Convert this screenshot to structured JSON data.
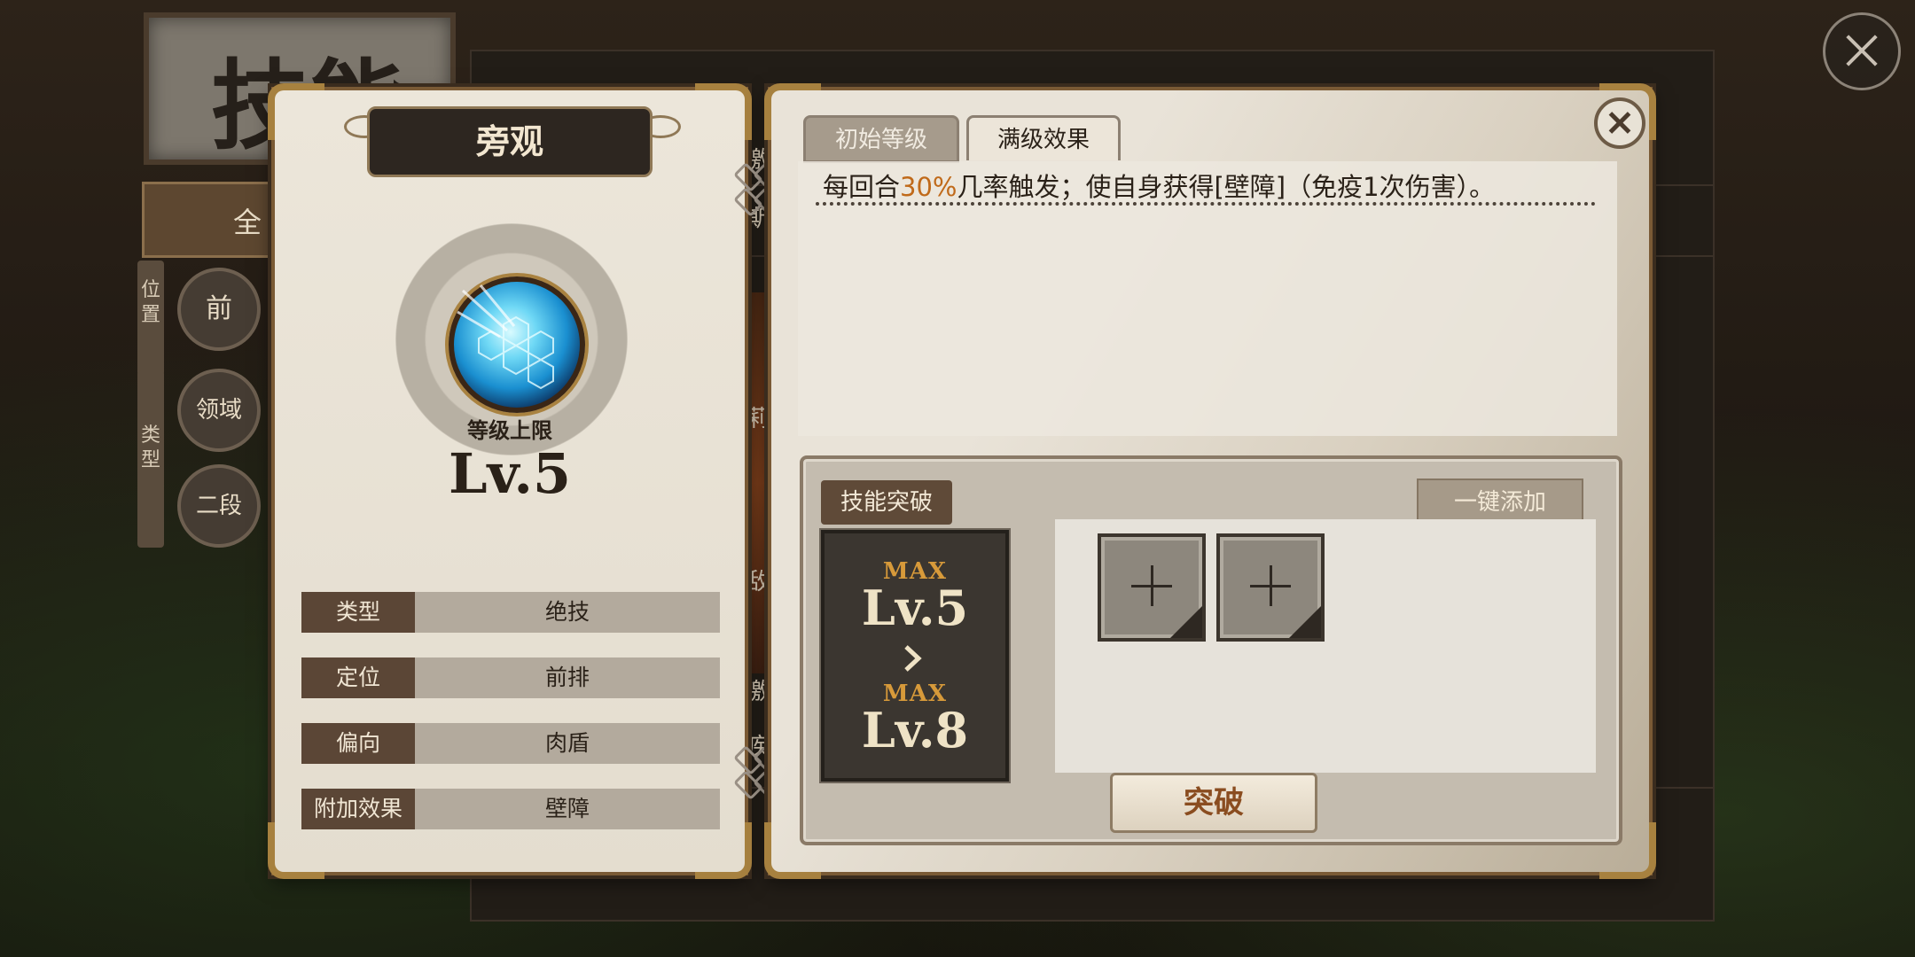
{
  "background": {
    "title": "技能",
    "tab_all_partial": "全",
    "side_position": "位置",
    "side_type": "类型",
    "circle_front": "前",
    "circle_domain": "领域",
    "circle_second": "二段",
    "strip_texts": [
      "激",
      "斯",
      "莉",
      "敌",
      "激",
      "疾"
    ]
  },
  "skill": {
    "name": "旁观",
    "cap_label": "等级上限",
    "cap_value": "Lv.5",
    "icon": "shield-hexagon-skill-icon",
    "attributes": [
      {
        "key": "类型",
        "value": "绝技"
      },
      {
        "key": "定位",
        "value": "前排"
      },
      {
        "key": "偏向",
        "value": "肉盾"
      },
      {
        "key": "附加效果",
        "value": "壁障"
      }
    ]
  },
  "detail": {
    "tabs": [
      {
        "label": "初始等级",
        "active": false
      },
      {
        "label": "满级效果",
        "active": true
      }
    ],
    "description_prefix": "每回合",
    "description_highlight": "30%",
    "description_suffix": "几率触发；使自身获得[壁障]（免疫1次伤害）。",
    "highlight_color": "#c06a1a"
  },
  "breakthrough": {
    "label": "技能突破",
    "add_all_button": "一键添加",
    "from_tag": "MAX",
    "from_level": "Lv.5",
    "to_tag": "MAX",
    "to_level": "Lv.8",
    "slot_count": 2,
    "button": "突破"
  }
}
